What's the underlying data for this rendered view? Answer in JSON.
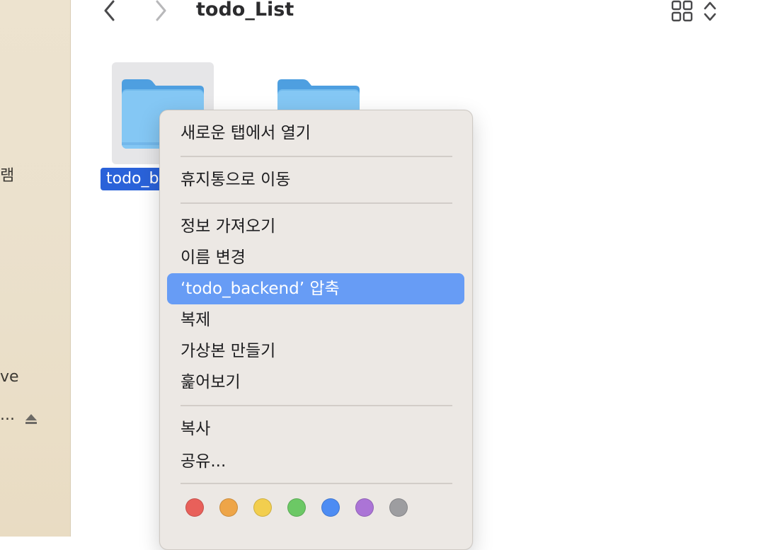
{
  "window": {
    "title": "todo_List"
  },
  "sidebar": {
    "items": [
      {
        "label": "램"
      },
      {
        "label": "ve"
      },
      {
        "label": "..."
      }
    ]
  },
  "folders": [
    {
      "label": "todo_b",
      "selected": true
    },
    {
      "label": "",
      "selected": false
    }
  ],
  "context_menu": {
    "items": [
      {
        "label": "새로운 탭에서 열기"
      },
      {
        "label": "휴지통으로 이동"
      },
      {
        "label": "정보 가져오기"
      },
      {
        "label": "이름 변경"
      },
      {
        "label": "‘todo_backend’ 압축",
        "highlighted": true
      },
      {
        "label": "복제"
      },
      {
        "label": "가상본 만들기"
      },
      {
        "label": "훑어보기"
      },
      {
        "label": "복사"
      },
      {
        "label": "공유..."
      }
    ],
    "tags": [
      {
        "name": "red",
        "color": "#e8605a"
      },
      {
        "name": "orange",
        "color": "#eea548"
      },
      {
        "name": "yellow",
        "color": "#f2ce4e"
      },
      {
        "name": "green",
        "color": "#6cc865"
      },
      {
        "name": "blue",
        "color": "#4d8cf3"
      },
      {
        "name": "purple",
        "color": "#ab74d6"
      },
      {
        "name": "gray",
        "color": "#9d9da0"
      }
    ]
  },
  "colors": {
    "selection": "#2a62d9",
    "menu_highlight": "#679cf5",
    "folder": "#6fb8ec"
  }
}
